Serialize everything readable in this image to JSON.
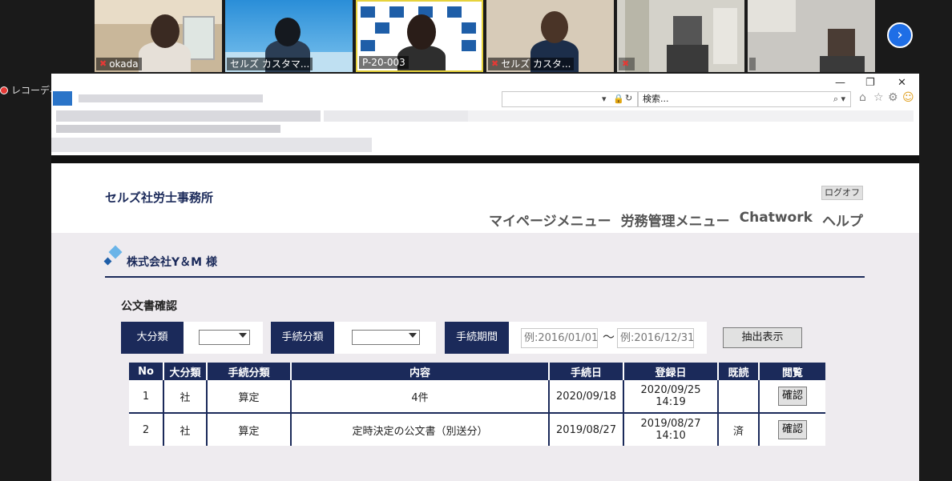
{
  "conference": {
    "participants": [
      {
        "name": "okada",
        "muted": true
      },
      {
        "name": "セルズ カスタマ...",
        "muted": false
      },
      {
        "name": "P-20-003",
        "muted": false
      },
      {
        "name": "セルズ カスタ...",
        "muted": true
      },
      {
        "name": "",
        "muted": true
      },
      {
        "name": "",
        "muted": false
      }
    ],
    "recording_label": "レコーディ"
  },
  "browser": {
    "search_placeholder": "検索...",
    "window_controls": {
      "minimize": "—",
      "restore": "❐",
      "close": "✕"
    }
  },
  "site": {
    "title": "セルズ社労士事務所",
    "logoff": "ログオフ",
    "nav": [
      "マイページメニュー",
      "労務管理メニュー",
      "Chatwork",
      "ヘルプ"
    ],
    "company": "株式会社Y＆M 様",
    "section_title": "公文書確認"
  },
  "filters": {
    "category_label": "大分類",
    "procedure_label": "手続分類",
    "period_label": "手続期間",
    "date_from_placeholder": "例:2016/01/01",
    "separator": "〜",
    "date_to_placeholder": "例:2016/12/31",
    "submit_label": "抽出表示"
  },
  "table": {
    "headers": [
      "No",
      "大分類",
      "手続分類",
      "内容",
      "手続日",
      "登録日",
      "既読",
      "閲覧"
    ],
    "rows": [
      {
        "no": "1",
        "category": "社",
        "procedure": "算定",
        "content": "4件",
        "proc_date": "2020/09/18",
        "reg_date": "2020/09/25 14:19",
        "read": "",
        "view": "確認"
      },
      {
        "no": "2",
        "category": "社",
        "procedure": "算定",
        "content": "定時決定の公文書（別送分）",
        "proc_date": "2019/08/27",
        "reg_date": "2019/08/27 14:10",
        "read": "済",
        "view": "確認"
      }
    ]
  },
  "colors": {
    "navy": "#1b2a5a",
    "content_bg": "#eeebef",
    "zoom_accent": "#1e6ee6"
  }
}
